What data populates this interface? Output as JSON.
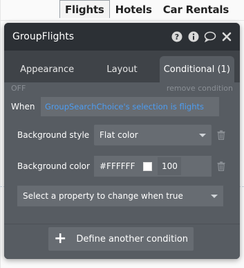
{
  "top_tabs": [
    {
      "label": "Flights",
      "active": true
    },
    {
      "label": "Hotels",
      "active": false
    },
    {
      "label": "Car Rentals",
      "active": false
    }
  ],
  "panel": {
    "title": "GroupFlights",
    "header_icons": [
      "help-icon",
      "info-icon",
      "comment-icon",
      "close-icon"
    ],
    "tabs": [
      {
        "label": "Appearance",
        "active": false
      },
      {
        "label": "Layout",
        "active": false
      },
      {
        "label": "Conditional (1)",
        "active": true
      }
    ]
  },
  "condition": {
    "status": "OFF",
    "remove_label": "remove condition",
    "when_label": "When",
    "when_expression": "GroupSearchChoice's selection is flights",
    "properties": [
      {
        "label": "Background style",
        "value": "Flat color"
      },
      {
        "label": "Background color",
        "hex": "#FFFFFF",
        "opacity": "100"
      }
    ],
    "add_property_placeholder": "Select a property to change when true"
  },
  "define_button_label": "Define another condition",
  "colors": {
    "panel_bg": "#3f4348",
    "header_bg": "#2c3035",
    "content_bg": "#575c62",
    "field_bg": "#676c72",
    "link_blue": "#4d9df2"
  }
}
